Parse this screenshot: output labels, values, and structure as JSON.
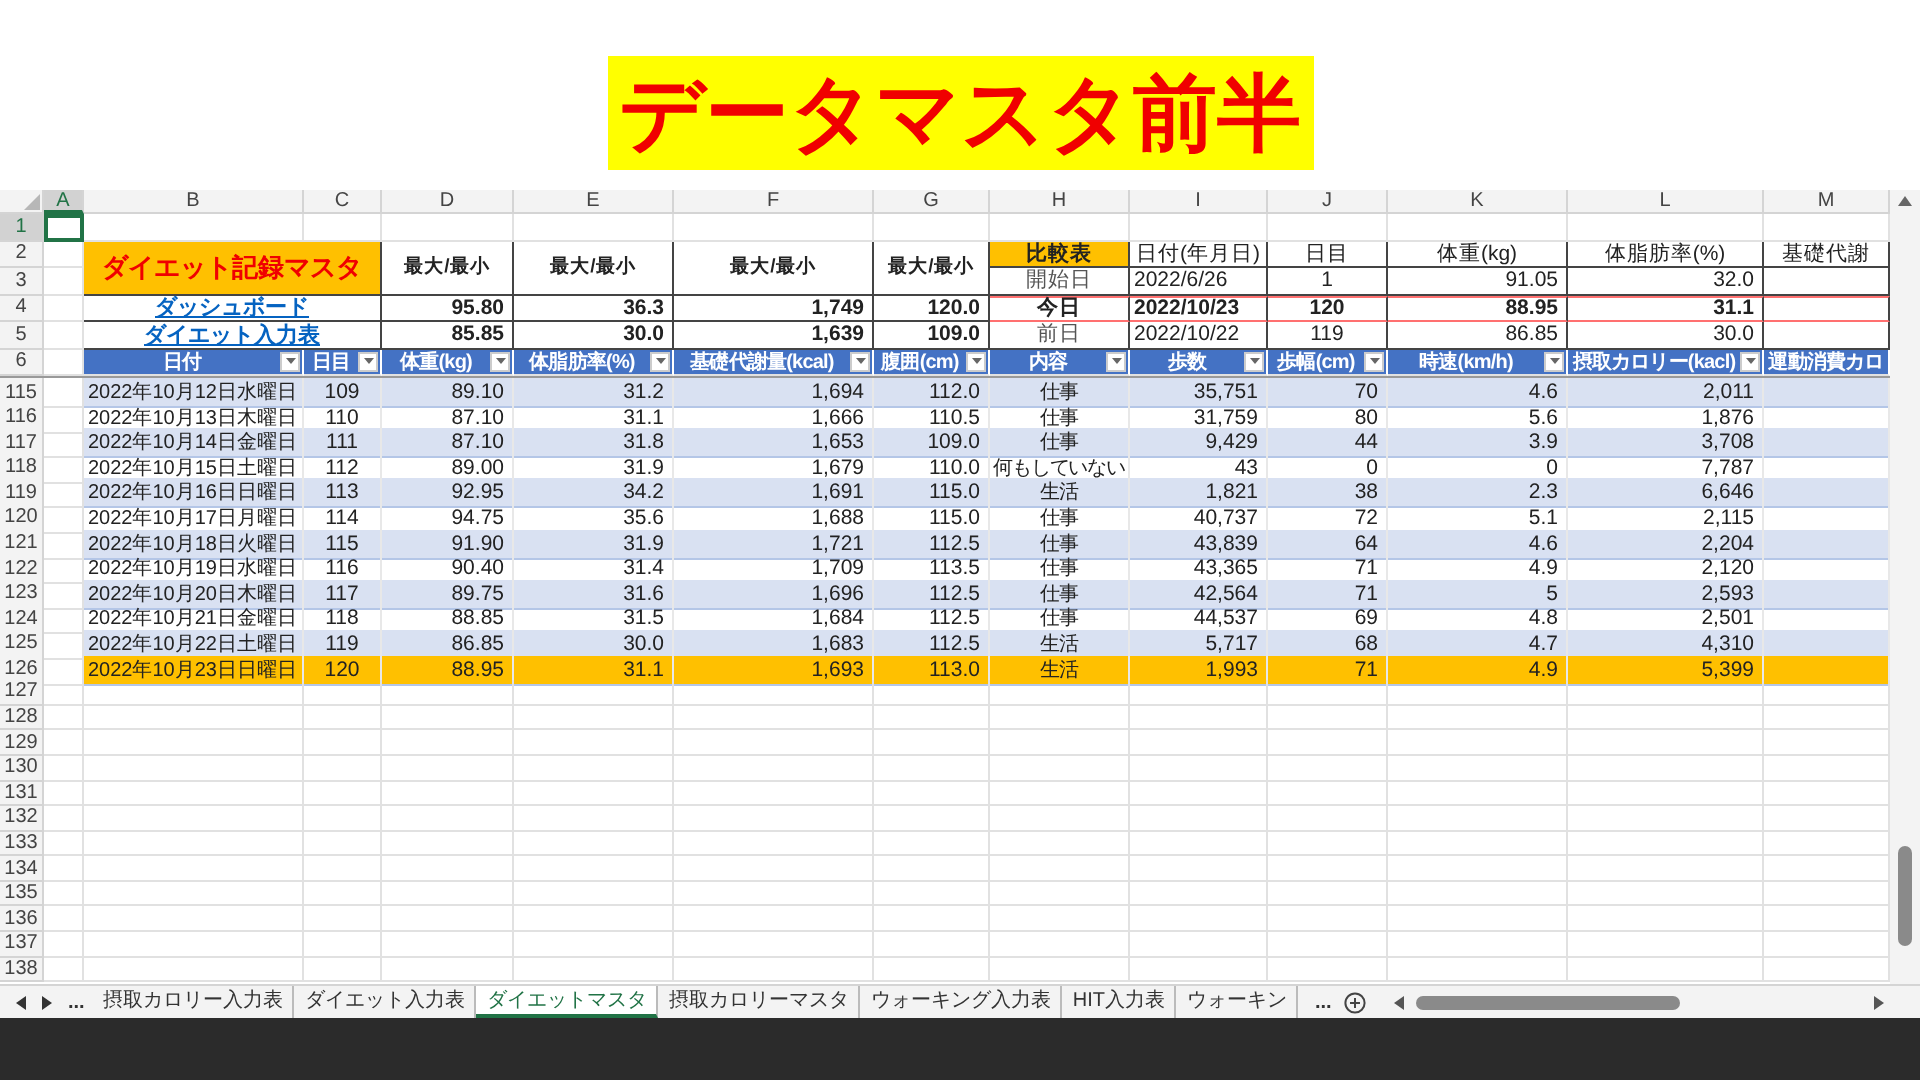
{
  "title_banner": "データマスタ前半",
  "column_letters": [
    {
      "label": "A",
      "selected": true
    },
    {
      "label": "B",
      "selected": false
    },
    {
      "label": "C",
      "selected": false
    },
    {
      "label": "D",
      "selected": false
    },
    {
      "label": "E",
      "selected": false
    },
    {
      "label": "F",
      "selected": false
    },
    {
      "label": "G",
      "selected": false
    },
    {
      "label": "H",
      "selected": false
    },
    {
      "label": "I",
      "selected": false
    },
    {
      "label": "J",
      "selected": false
    },
    {
      "label": "K",
      "selected": false
    },
    {
      "label": "L",
      "selected": false
    },
    {
      "label": "M",
      "selected": false
    }
  ],
  "top_row_numbers": [
    {
      "label": "1",
      "selected": true
    },
    {
      "label": "2",
      "selected": false
    },
    {
      "label": "3",
      "selected": false
    },
    {
      "label": "4",
      "selected": false
    },
    {
      "label": "5",
      "selected": false
    },
    {
      "label": "6",
      "selected": false
    }
  ],
  "master_title": "ダイエット記録マスタ",
  "links": [
    "ダッシュボード",
    "ダイエット入力表"
  ],
  "max_min_labels": [
    "最大/最小",
    "最大/最小",
    "最大/最小",
    "最大/最小"
  ],
  "max_values": [
    "95.80",
    "36.3",
    "1,749",
    "120.0"
  ],
  "min_values": [
    "85.85",
    "30.0",
    "1,639",
    "109.0"
  ],
  "comparison": {
    "title": "比較表",
    "headers": [
      "日付(年月日)",
      "日目",
      "体重(kg)",
      "体脂肪率(%)",
      "基礎代謝"
    ],
    "rows": [
      {
        "label": "開始日",
        "values": [
          "2022/6/26",
          "1",
          "91.05",
          "32.0"
        ],
        "emphasized": false
      },
      {
        "label": "今日",
        "values": [
          "2022/10/23",
          "120",
          "88.95",
          "31.1"
        ],
        "emphasized": true
      },
      {
        "label": "前日",
        "values": [
          "2022/10/22",
          "119",
          "86.85",
          "30.0"
        ],
        "emphasized": false
      }
    ]
  },
  "table": {
    "columns": [
      {
        "label": "日付",
        "filter": true
      },
      {
        "label": "日目",
        "filter": true
      },
      {
        "label": "体重(kg)",
        "filter": true
      },
      {
        "label": "体脂肪率(%)",
        "filter": true
      },
      {
        "label": "基礎代謝量(kcal)",
        "filter": true
      },
      {
        "label": "腹囲(cm)",
        "filter": true
      },
      {
        "label": "内容",
        "filter": true
      },
      {
        "label": "歩数",
        "filter": true
      },
      {
        "label": "歩幅(cm)",
        "filter": true
      },
      {
        "label": "時速(km/h)",
        "filter": true
      },
      {
        "label": "摂取カロリー(kacl)",
        "filter": true
      },
      {
        "label": "運動消費カロ",
        "filter": false
      }
    ],
    "rows": [
      {
        "row": "115",
        "cells": [
          "2022年10月12日水曜日",
          "109",
          "89.10",
          "31.2",
          "1,694",
          "112.0",
          "仕事",
          "35,751",
          "70",
          "4.6",
          "2,011"
        ],
        "highlighted": false
      },
      {
        "row": "116",
        "cells": [
          "2022年10月13日木曜日",
          "110",
          "87.10",
          "31.1",
          "1,666",
          "110.5",
          "仕事",
          "31,759",
          "80",
          "5.6",
          "1,876"
        ],
        "highlighted": false
      },
      {
        "row": "117",
        "cells": [
          "2022年10月14日金曜日",
          "111",
          "87.10",
          "31.8",
          "1,653",
          "109.0",
          "仕事",
          "9,429",
          "44",
          "3.9",
          "3,708"
        ],
        "highlighted": false
      },
      {
        "row": "118",
        "cells": [
          "2022年10月15日土曜日",
          "112",
          "89.00",
          "31.9",
          "1,679",
          "110.0",
          "何もしていない",
          "43",
          "0",
          "0",
          "7,787"
        ],
        "highlighted": false
      },
      {
        "row": "119",
        "cells": [
          "2022年10月16日日曜日",
          "113",
          "92.95",
          "34.2",
          "1,691",
          "115.0",
          "生活",
          "1,821",
          "38",
          "2.3",
          "6,646"
        ],
        "highlighted": false
      },
      {
        "row": "120",
        "cells": [
          "2022年10月17日月曜日",
          "114",
          "94.75",
          "35.6",
          "1,688",
          "115.0",
          "仕事",
          "40,737",
          "72",
          "5.1",
          "2,115"
        ],
        "highlighted": false
      },
      {
        "row": "121",
        "cells": [
          "2022年10月18日火曜日",
          "115",
          "91.90",
          "31.9",
          "1,721",
          "112.5",
          "仕事",
          "43,839",
          "64",
          "4.6",
          "2,204"
        ],
        "highlighted": false
      },
      {
        "row": "122",
        "cells": [
          "2022年10月19日水曜日",
          "116",
          "90.40",
          "31.4",
          "1,709",
          "113.5",
          "仕事",
          "43,365",
          "71",
          "4.9",
          "2,120"
        ],
        "highlighted": false
      },
      {
        "row": "123",
        "cells": [
          "2022年10月20日木曜日",
          "117",
          "89.75",
          "31.6",
          "1,696",
          "112.5",
          "仕事",
          "42,564",
          "71",
          "5",
          "2,593"
        ],
        "highlighted": false
      },
      {
        "row": "124",
        "cells": [
          "2022年10月21日金曜日",
          "118",
          "88.85",
          "31.5",
          "1,684",
          "112.5",
          "仕事",
          "44,537",
          "69",
          "4.8",
          "2,501"
        ],
        "highlighted": false
      },
      {
        "row": "125",
        "cells": [
          "2022年10月22日土曜日",
          "119",
          "86.85",
          "30.0",
          "1,683",
          "112.5",
          "生活",
          "5,717",
          "68",
          "4.7",
          "4,310"
        ],
        "highlighted": false
      },
      {
        "row": "126",
        "cells": [
          "2022年10月23日日曜日",
          "120",
          "88.95",
          "31.1",
          "1,693",
          "113.0",
          "生活",
          "1,993",
          "71",
          "4.9",
          "5,399"
        ],
        "highlighted": true
      }
    ]
  },
  "empty_rows": [
    "127",
    "128",
    "129",
    "130",
    "131",
    "132",
    "133",
    "134",
    "135",
    "136",
    "137",
    "138"
  ],
  "sheet_tabs": [
    {
      "label": "摂取カロリー入力表",
      "selected": false
    },
    {
      "label": "ダイエット入力表",
      "selected": false
    },
    {
      "label": "ダイエットマスタ",
      "selected": true
    },
    {
      "label": "摂取カロリーマスタ",
      "selected": false
    },
    {
      "label": "ウォーキング入力表",
      "selected": false
    },
    {
      "label": "HIT入力表",
      "selected": false
    },
    {
      "label": "ウォーキン",
      "selected": false
    }
  ],
  "tab_overflow": [
    "...",
    "..."
  ]
}
